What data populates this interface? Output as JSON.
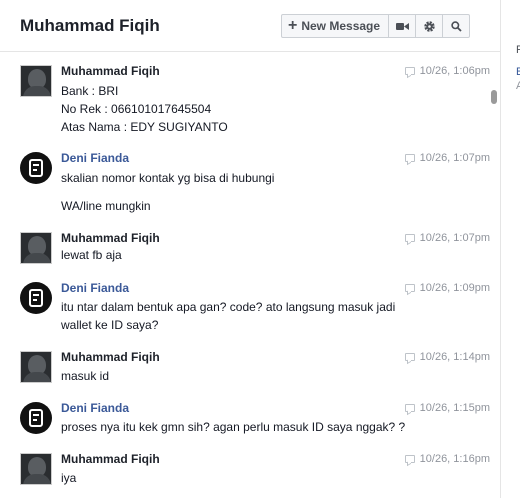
{
  "conversation": {
    "title": "Muhammad Fiqih",
    "new_message_label": "New Message"
  },
  "right_column": {
    "line1": "F",
    "line2": "E",
    "line3": "A"
  },
  "messages": [
    {
      "sender": "Muhammad Fiqih",
      "time": "10/26, 1:06pm",
      "lines": [
        "Bank : BRI",
        "No Rek : 066101017645504",
        "Atas Nama : EDY SUGIYANTO"
      ]
    },
    {
      "sender": "Deni Fianda",
      "time": "10/26, 1:07pm",
      "lines": [
        "skalian nomor kontak yg bisa di hubungi",
        "WA/line mungkin"
      ]
    },
    {
      "sender": "Muhammad Fiqih",
      "time": "10/26, 1:07pm",
      "lines": [
        "lewat fb aja"
      ]
    },
    {
      "sender": "Deni Fianda",
      "time": "10/26, 1:09pm",
      "lines": [
        "itu ntar dalam bentuk apa gan? code? ato langsung masuk jadi",
        "wallet ke ID saya?"
      ]
    },
    {
      "sender": "Muhammad Fiqih",
      "time": "10/26, 1:14pm",
      "lines": [
        "masuk id"
      ]
    },
    {
      "sender": "Deni Fianda",
      "time": "10/26, 1:15pm",
      "lines": [
        "proses nya itu kek gmn sih? agan perlu masuk ID saya nggak? ?"
      ]
    },
    {
      "sender": "Muhammad Fiqih",
      "time": "10/26, 1:16pm",
      "lines": [
        "iya"
      ]
    }
  ]
}
